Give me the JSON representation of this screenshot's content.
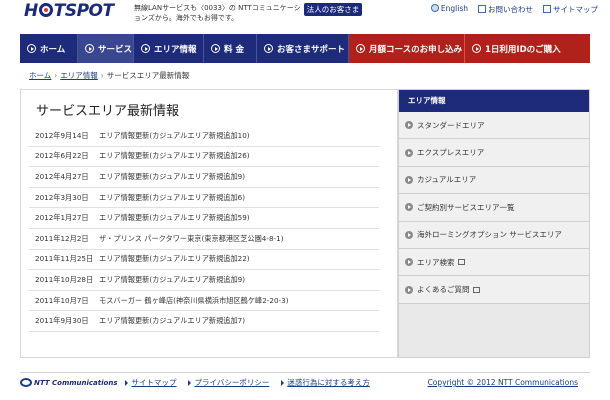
{
  "header": {
    "logo": "HOTSPOT",
    "tagline": "無線LANサービスも〈0033〉の NTTコミュニケーションズから。海外でもお得です。",
    "corp_button": "法人のお客さま",
    "links": [
      {
        "label": "English",
        "icon": "globe-icon"
      },
      {
        "label": "お問い合わせ",
        "icon": "mail-icon"
      },
      {
        "label": "サイトマップ",
        "icon": "sitemap-icon"
      }
    ]
  },
  "nav": {
    "items": [
      {
        "label": "ホーム",
        "width": 58
      },
      {
        "label": "サービス",
        "width": 56
      },
      {
        "label": "エリア情報",
        "width": 70
      },
      {
        "label": "料 金",
        "width": 53
      },
      {
        "label": "お客さまサポート",
        "width": 92
      },
      {
        "label": "月額コースのお申し込み",
        "width": 116
      },
      {
        "label": "1日利用IDのご購入",
        "width": 125
      }
    ]
  },
  "breadcrumb": {
    "home": "ホーム",
    "area": "エリア情報",
    "current": "サービスエリア最新情報"
  },
  "main": {
    "title": "サービスエリア最新情報",
    "news": [
      {
        "date": "2012年9月14日",
        "text": "エリア情報更新(カジュアルエリア新規追加10)"
      },
      {
        "date": "2012年6月22日",
        "text": "エリア情報更新(カジュアルエリア新規追加26)"
      },
      {
        "date": "2012年4月27日",
        "text": "エリア情報更新(カジュアルエリア新規追加9)"
      },
      {
        "date": "2012年3月30日",
        "text": "エリア情報更新(カジュアルエリア新規追加6)"
      },
      {
        "date": "2012年1月27日",
        "text": "エリア情報更新(カジュアルエリア新規追加59)"
      },
      {
        "date": "2011年12月2日",
        "text": "ザ・プリンス パークタワー東京(東京都港区芝公園4-8-1)"
      },
      {
        "date": "2011年11月25日",
        "text": "エリア情報更新(カジュアルエリア新規追加22)"
      },
      {
        "date": "2011年10月28日",
        "text": "エリア情報更新(カジュアルエリア新規追加9)"
      },
      {
        "date": "2011年10月7日",
        "text": "モスバーガー 鶴ヶ峰店(神奈川県横浜市旭区鶴ケ峰2-20-3)"
      },
      {
        "date": "2011年9月30日",
        "text": "エリア情報更新(カジュアルエリア新規追加7)"
      }
    ]
  },
  "sidebar": {
    "heading": "エリア情報",
    "items": [
      {
        "label": "スタンダードエリア",
        "external": false
      },
      {
        "label": "エクスプレスエリア",
        "external": false
      },
      {
        "label": "カジュアルエリア",
        "external": false
      },
      {
        "label": "ご契約別サービスエリア一覧",
        "external": false
      },
      {
        "label": "海外ローミングオプション サービスエリア",
        "external": false
      },
      {
        "label": "エリア検索",
        "external": true
      },
      {
        "label": "よくあるご質問",
        "external": true
      }
    ]
  },
  "footer": {
    "logo": "NTT Communications",
    "links": [
      "サイトマップ",
      "プライバシーポリシー",
      "迷惑行為に対する考え方"
    ],
    "copyright": "Copyright © 2012 NTT Communications"
  }
}
